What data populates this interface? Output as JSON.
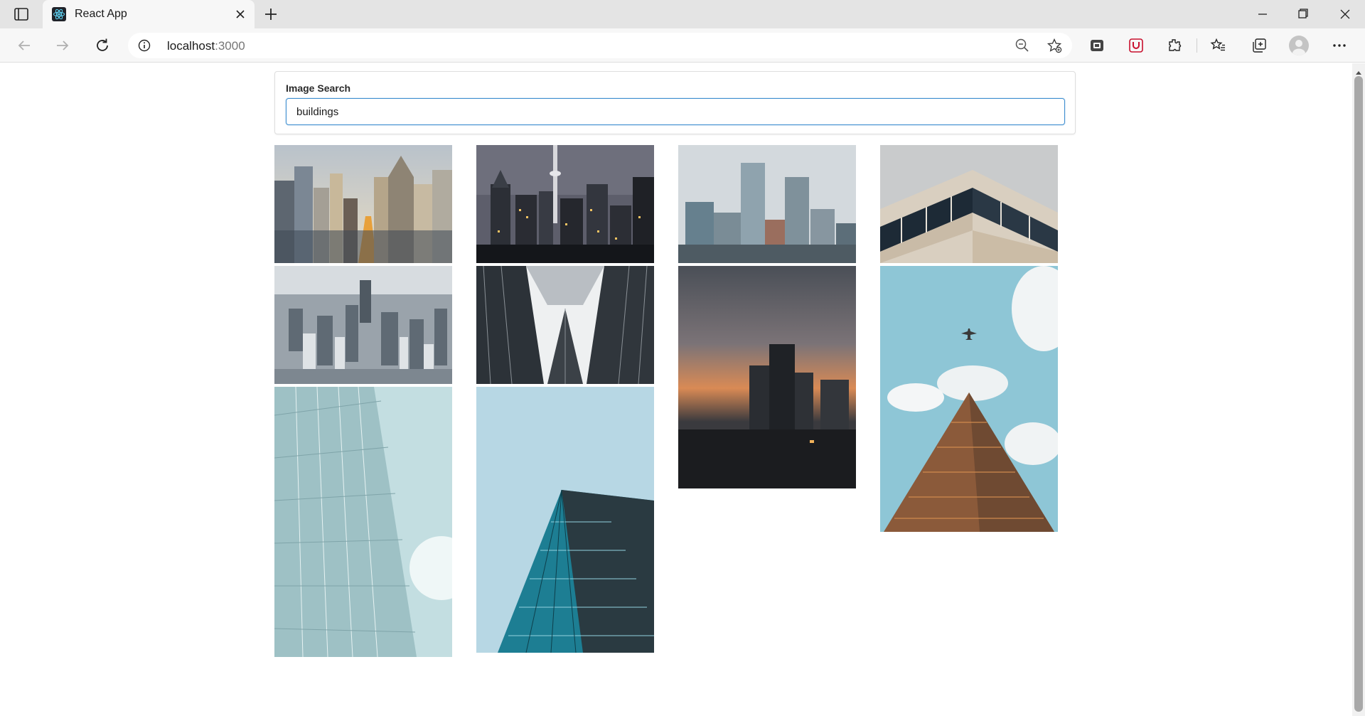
{
  "browser": {
    "tab": {
      "title": "React App"
    },
    "address": {
      "host": "localhost",
      "port": ":3000"
    }
  },
  "search": {
    "label": "Image Search",
    "value": "buildings"
  },
  "gallery": {
    "images": [
      {
        "subject": "city skyline at sunset with tall skyscrapers and sunlit avenue"
      },
      {
        "subject": "night city skyline with tv tower and lit windows"
      },
      {
        "subject": "downtown skyscrapers under overcast sky"
      },
      {
        "subject": "modern office building corner with glass and beige facade"
      },
      {
        "subject": "aerial view of dense city skyscrapers"
      },
      {
        "subject": "looking up between glass towers"
      },
      {
        "subject": "skyscrapers silhouetted against orange sunset"
      },
      {
        "subject": "airplane flying over a tall brown skyscraper"
      },
      {
        "subject": "close-up of glass curtain wall with sunlight"
      },
      {
        "subject": "looking up at a blue glass skyscraper"
      }
    ]
  },
  "colors": {
    "accent": "#3e8ed0",
    "chrome": "#e4e4e4",
    "toolbar": "#f7f7f7"
  }
}
